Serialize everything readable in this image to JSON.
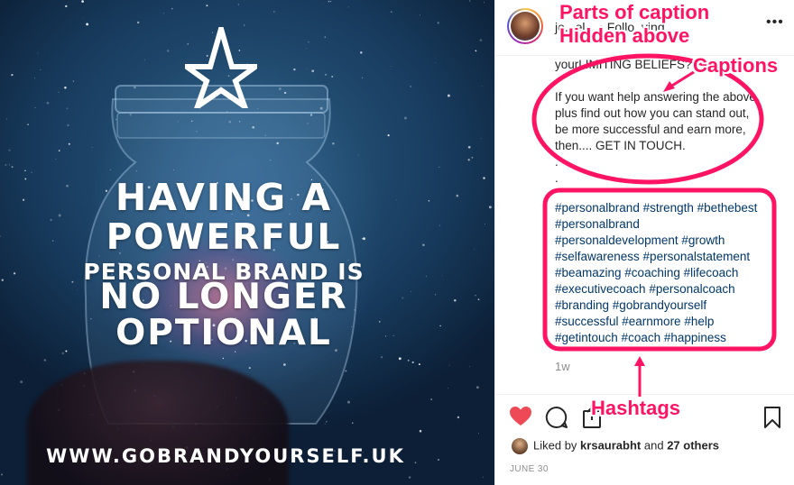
{
  "image": {
    "headline_lines": [
      "HAVING A",
      "POWERFUL",
      "PERSONAL BRAND IS",
      "NO LONGER",
      "OPTIONAL"
    ],
    "website": "WWW.GOBRANDYOURSELF.UK"
  },
  "header": {
    "username_text": "jo...el... • Follo..ving",
    "more_icon": "more-horizontal-icon"
  },
  "caption": {
    "line_top": "yourLIMITING BELIEFS?",
    "paragraph": [
      "If you want help answering the above,",
      "plus find out how you can stand out,",
      "be more successful and earn more,",
      "then.... GET IN TOUCH."
    ],
    "dots": [
      ".",
      "."
    ]
  },
  "hashtags": [
    "#personalbrand #strength #bethebest",
    "#personalbrand",
    "#personaldevelopment #growth",
    "#selfawareness #personalstatement",
    "#beamazing #coaching #lifecoach",
    "#executivecoach #personalcoach",
    "#branding #gobrandyourself",
    "#successful #earnmore #help",
    "#getintouch #coach #happiness"
  ],
  "time_ago": "1w",
  "likes": {
    "prefix": "Liked by",
    "user": "krsaurabht",
    "middle": "and",
    "count": "27 others"
  },
  "date": "JUNE 30",
  "annotations": {
    "parts": "Parts of caption",
    "hidden": "Hidden above",
    "captions": "Captions",
    "hashtags": "Hashtags",
    "color": "#ff1463"
  },
  "colors": {
    "heart": "#ed4956",
    "hashtag": "#00376b",
    "muted": "#8e8e8e"
  }
}
